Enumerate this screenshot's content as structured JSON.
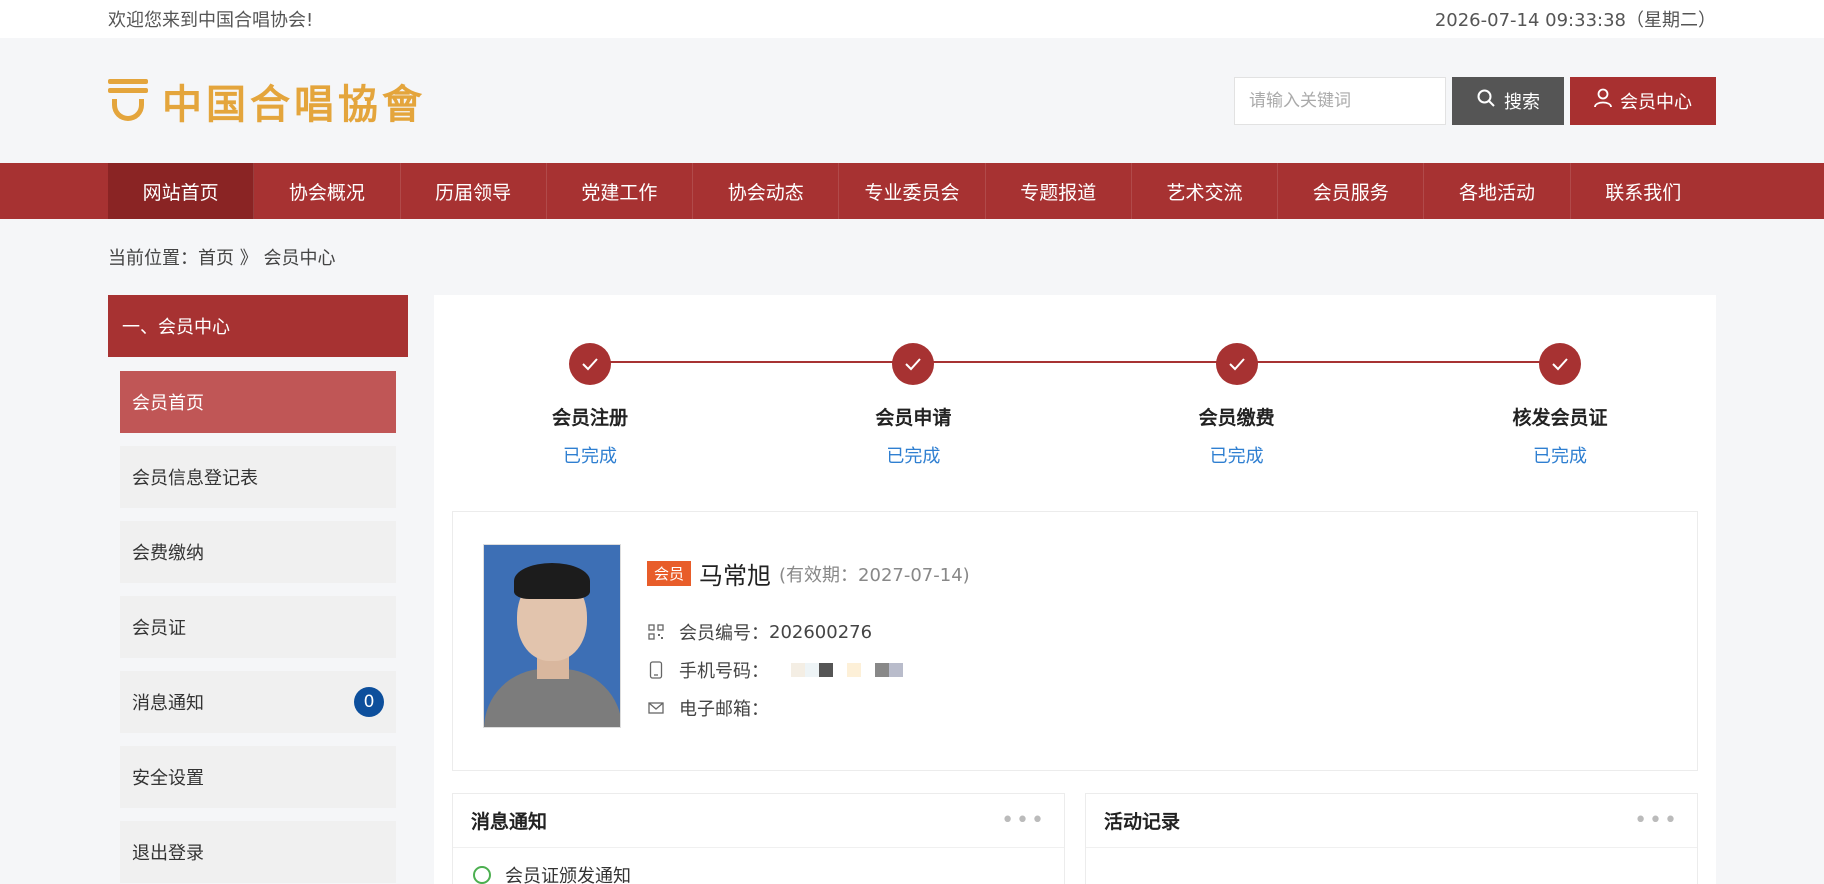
{
  "topbar": {
    "welcome": "欢迎您来到中国合唱协会!",
    "datetime": "2026-07-14 09:33:38（星期二）"
  },
  "header": {
    "logo_text": "中国合唱協會",
    "search_placeholder": "请输入关键词",
    "search_label": "搜索",
    "member_label": "会员中心"
  },
  "nav": [
    "网站首页",
    "协会概况",
    "历届领导",
    "党建工作",
    "协会动态",
    "专业委员会",
    "专题报道",
    "艺术交流",
    "会员服务",
    "各地活动",
    "联系我们"
  ],
  "breadcrumb": "当前位置：首页 》 会员中心",
  "sidebar": {
    "title": "一、会员中心",
    "items": [
      {
        "label": "会员首页"
      },
      {
        "label": "会员信息登记表"
      },
      {
        "label": "会费缴纳"
      },
      {
        "label": "会员证"
      },
      {
        "label": "消息通知",
        "badge": "0"
      },
      {
        "label": "安全设置"
      },
      {
        "label": "退出登录"
      }
    ]
  },
  "steps": [
    {
      "title": "会员注册",
      "status": "已完成"
    },
    {
      "title": "会员申请",
      "status": "已完成"
    },
    {
      "title": "会员缴费",
      "status": "已完成"
    },
    {
      "title": "核发会员证",
      "status": "已完成"
    }
  ],
  "profile": {
    "tag": "会员",
    "name": "马常旭",
    "validity": "(有效期：2027-07-14)",
    "member_no_label": "会员编号：",
    "member_no": "202600276",
    "phone_label": "手机号码：",
    "email_label": "电子邮箱："
  },
  "panels": {
    "notice": {
      "title": "消息通知",
      "items": [
        "会员证颁发通知"
      ]
    },
    "activity": {
      "title": "活动记录"
    }
  },
  "colors": {
    "brand": "#a73232",
    "gold": "#e4a53c",
    "link": "#2f7fd1"
  }
}
